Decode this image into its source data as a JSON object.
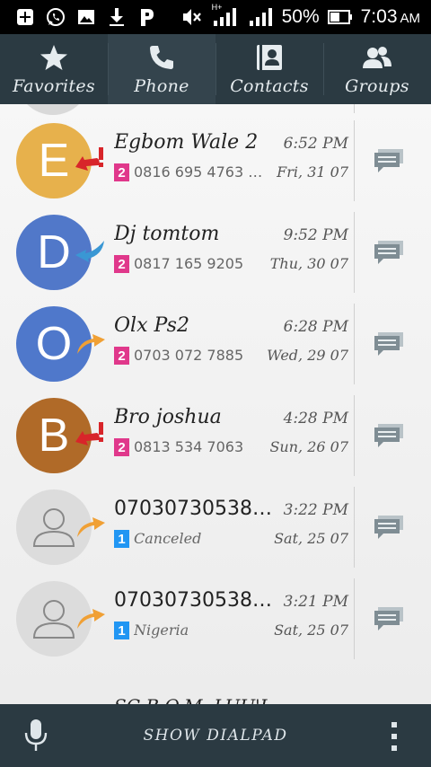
{
  "status_bar": {
    "battery": "50%",
    "time": "7:03",
    "ampm": "AM",
    "network_type": "H+",
    "icons": [
      "add-icon",
      "whatsapp-icon",
      "gallery-icon",
      "download-icon",
      "p-app-icon",
      "mute-icon",
      "signal-icon",
      "signal-icon",
      "battery-icon"
    ]
  },
  "tabs": [
    {
      "label": "Favorites",
      "icon": "star-icon",
      "active": false
    },
    {
      "label": "Phone",
      "icon": "phone-icon",
      "active": true
    },
    {
      "label": "Contacts",
      "icon": "contact-card-icon",
      "active": false
    },
    {
      "label": "Groups",
      "icon": "group-icon",
      "active": false
    }
  ],
  "calls": [
    {
      "initial": "E",
      "avatar_color": "#e7b14c",
      "name": "Egbom Wale 2",
      "time": "6:52 PM",
      "sim": "2",
      "detail": "0816 695 4763 M...",
      "date": "Fri, 31 07",
      "call_type": "missed"
    },
    {
      "initial": "D",
      "avatar_color": "#5178c9",
      "name": "Dj tomtom",
      "time": "9:52 PM",
      "sim": "2",
      "detail": "0817 165 9205",
      "date": "Thu, 30 07",
      "call_type": "incoming"
    },
    {
      "initial": "O",
      "avatar_color": "#4f78cb",
      "name": "Olx Ps2",
      "time": "6:28 PM",
      "sim": "2",
      "detail": "0703 072 7885",
      "date": "Wed, 29 07",
      "call_type": "outgoing"
    },
    {
      "initial": "B",
      "avatar_color": "#b06a28",
      "name": "Bro joshua",
      "time": "4:28 PM",
      "sim": "2",
      "detail": "0813 534 7063",
      "date": "Sun, 26 07",
      "call_type": "missed"
    },
    {
      "initial": "",
      "avatar_color": "#dcdcdc",
      "name": "07030730538*...",
      "time": "3:22 PM",
      "sim": "1",
      "detail": "Canceled",
      "date": "Sat, 25 07",
      "call_type": "outgoing"
    },
    {
      "initial": "",
      "avatar_color": "#dcdcdc",
      "name": "07030730538#...",
      "time": "3:21 PM",
      "sim": "1",
      "detail": "Nigeria",
      "date": "Sat, 25 07",
      "call_type": "outgoing"
    }
  ],
  "partial_row": {
    "name": "SC B.O.M. LUU'L",
    "avatar_color": "#d84b3a"
  },
  "bottom_bar": {
    "dialpad_label": "SHOW DIALPAD",
    "mic_icon": "microphone-icon",
    "overflow_icon": "overflow-menu-icon"
  },
  "colors": {
    "header_bg": "#2b3a42",
    "active_tab_bg": "#34444d",
    "missed": "#d8252a",
    "incoming": "#3a97d4",
    "outgoing": "#f0a035",
    "sim1": "#2196f3",
    "sim2": "#e0388b"
  }
}
